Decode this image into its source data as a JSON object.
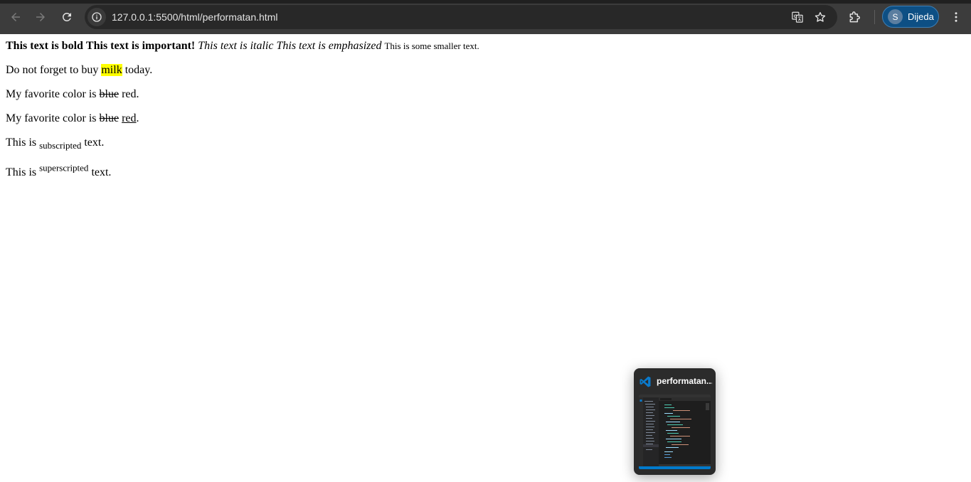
{
  "browser": {
    "url": "127.0.0.1:5500/html/performatan.html",
    "profile_initial": "S",
    "profile_name": "Dijeda",
    "icons": {
      "back": "back-arrow-icon",
      "forward": "forward-arrow-icon",
      "reload": "reload-icon",
      "site_info": "site-info-icon",
      "translate": "translate-icon",
      "bookmark": "star-icon",
      "extensions": "puzzle-icon",
      "menu": "kebab-menu-icon"
    },
    "colors": {
      "chrome_bg": "#3c3c3c",
      "omnibox_bg": "#282828",
      "profile_bg": "#0d4f84"
    }
  },
  "content": {
    "line1": {
      "bold": "This text is bold",
      "strong": "This text is important!",
      "italic": "This text is italic",
      "em": "This text is emphasized",
      "small": "This is some smaller text."
    },
    "line2": {
      "before": "Do not forget to buy",
      "mark": "milk",
      "after": "today."
    },
    "line3": {
      "before": "My favorite color is",
      "del": "blue",
      "after": "red."
    },
    "line4": {
      "before": "My favorite color is",
      "del": "blue",
      "ins": "red",
      "after": "."
    },
    "line5": {
      "before": "This is",
      "sub": "subscripted",
      "after": "text."
    },
    "line6": {
      "before": "This is",
      "sup": "superscripted",
      "after": "text."
    },
    "highlight_color": "#ffff00"
  },
  "taskbar_preview": {
    "app_icon": "vscode-icon",
    "title": "performatan..."
  }
}
